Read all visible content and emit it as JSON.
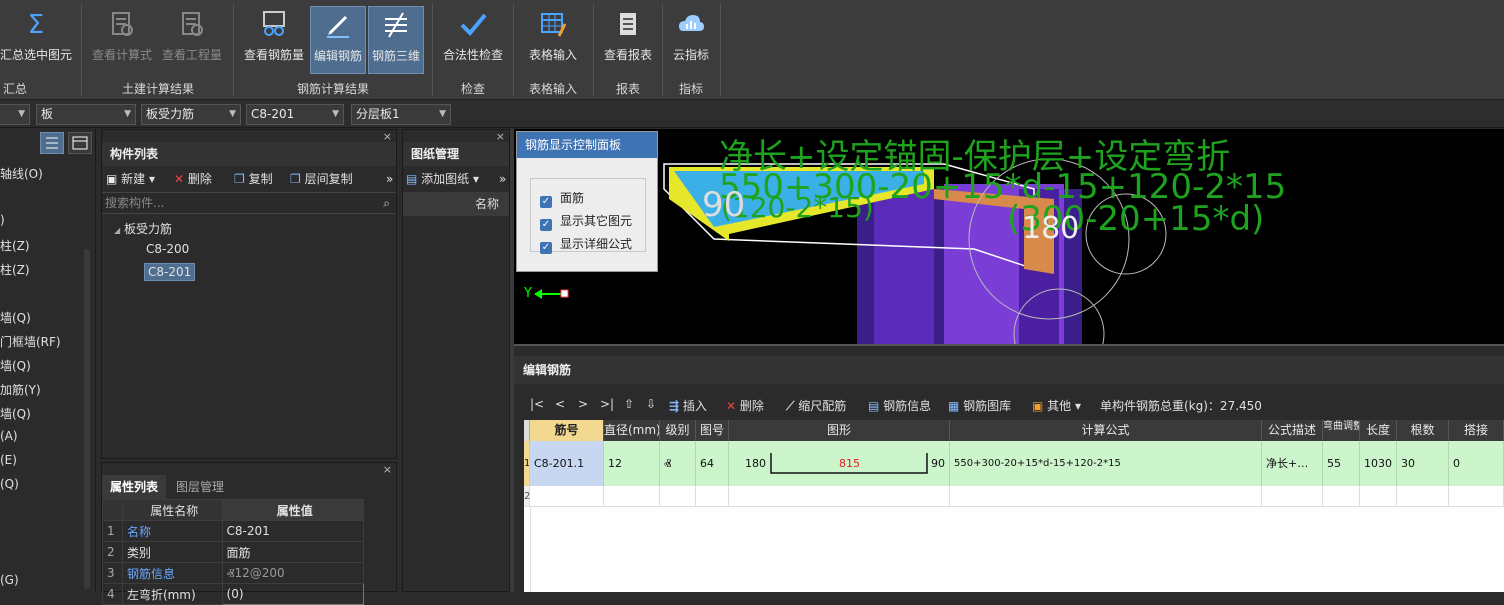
{
  "ribbon": {
    "buttons": [
      {
        "label": "汇总选中图元",
        "state": "normal"
      },
      {
        "label": "查看计算式",
        "state": "disabled"
      },
      {
        "label": "查看工程量",
        "state": "disabled"
      },
      {
        "label": "查看钢筋量",
        "state": "normal"
      },
      {
        "label": "编辑钢筋",
        "state": "active"
      },
      {
        "label": "钢筋三维",
        "state": "active"
      },
      {
        "label": "合法性检查",
        "state": "normal"
      },
      {
        "label": "表格输入",
        "state": "normal"
      },
      {
        "label": "查看报表",
        "state": "normal"
      },
      {
        "label": "云指标",
        "state": "normal"
      }
    ],
    "groups": [
      "汇总",
      "土建计算结果",
      "钢筋计算结果",
      "检查",
      "表格输入",
      "报表",
      "指标"
    ]
  },
  "dropdowns": [
    "",
    "板",
    "板受力筋",
    "C8-201",
    "分层板1"
  ],
  "left_nav": [
    "轴线(O)",
    ")",
    "柱(Z)",
    "柱(Z)",
    "墙(Q)",
    "门框墙(RF)",
    "墙(Q)",
    "加筋(Y)",
    "墙(Q)",
    "(A)",
    "(E)",
    "(Q)",
    "(G)"
  ],
  "component_list": {
    "title": "构件列表",
    "tools": {
      "new": "新建",
      "delete": "删除",
      "copy": "复制",
      "floor_copy": "层间复制"
    },
    "search_placeholder": "搜索构件...",
    "tree": {
      "parent": "板受力筋",
      "children": [
        "C8-200",
        "C8-201"
      ],
      "selected": "C8-201"
    }
  },
  "drawing_mgmt": {
    "title": "图纸管理",
    "add": "添加图纸",
    "col_name": "名称"
  },
  "property_panel": {
    "tabs": [
      "属性列表",
      "图层管理"
    ],
    "headers": [
      "属性名称",
      "属性值"
    ],
    "rows": [
      {
        "n": "1",
        "name": "名称",
        "value": "C8-201"
      },
      {
        "n": "2",
        "name": "类别",
        "value": "面筋"
      },
      {
        "n": "3",
        "name": "钢筋信息",
        "value": "Ⱏ12@200"
      },
      {
        "n": "4",
        "name": "左弯折(mm)",
        "value": "(0)"
      }
    ]
  },
  "control_panel": {
    "title": "钢筋显示控制面板",
    "options": [
      "面筋",
      "显示其它图元",
      "显示详细公式"
    ]
  },
  "viewport": {
    "formula_line1": "净长+设定锚固-保护层+设定弯折",
    "formula_line2": "550+300-20+15*d-15+120-2*15",
    "label_left": "(120-2*15)",
    "label_right": "(300-20+15*d)",
    "dim_left": "90",
    "dim_right": "180",
    "axis_label": "Y"
  },
  "editor": {
    "title": "编辑钢筋",
    "nav": [
      "|<",
      "<",
      ">",
      ">|"
    ],
    "tools": {
      "insert": "插入",
      "delete": "删除",
      "scale": "缩尺配筋",
      "info": "钢筋信息",
      "lib": "钢筋图库",
      "other": "其他"
    },
    "total_label": "单构件钢筋总重(kg)：27.450",
    "columns": [
      "筋号",
      "直径(mm)",
      "级别",
      "图号",
      "图形",
      "计算公式",
      "公式描述",
      "弯曲调整",
      "长度",
      "根数",
      "搭接"
    ],
    "rows": [
      {
        "n": "1",
        "bar_no": "C8-201.1",
        "diameter": "12",
        "grade": "Ⱏ",
        "fig_no": "64",
        "shape_left": "180",
        "shape_mid": "815",
        "shape_right": "90",
        "formula": "550+300-20+15*d-15+120-2*15",
        "desc": "净长+…",
        "bend_adj": "55",
        "length": "1030",
        "count": "30",
        "lap": "0"
      }
    ],
    "empty_row_n": "2"
  },
  "colors": {
    "accent": "#3e73b4",
    "row_green": "#ccf5cc",
    "formula_green": "#1fa31f"
  }
}
